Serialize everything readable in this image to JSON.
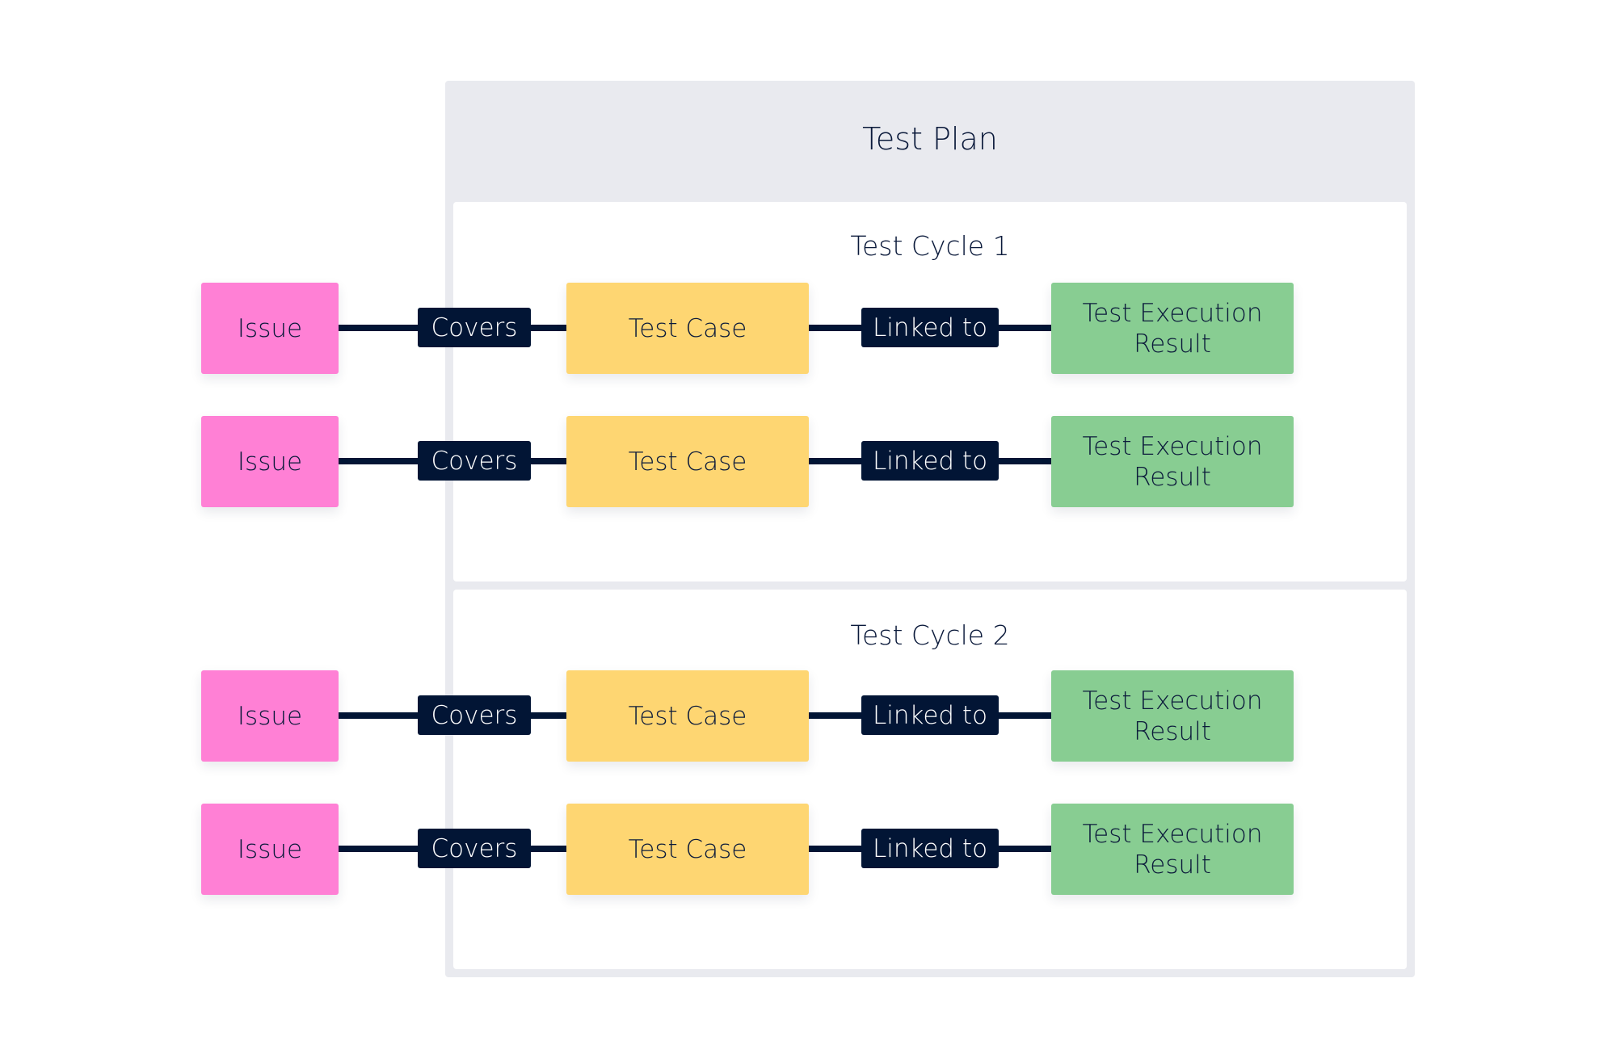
{
  "diagram": {
    "title": "Test Plan",
    "colors": {
      "frame": "#e9eaef",
      "issue": "#ff80d5",
      "test_case": "#fed672",
      "test_execution_result": "#88cd92",
      "connector": "#021535",
      "text": "#0b1a3b"
    },
    "cycles": [
      {
        "title": "Test Cycle 1",
        "rows": [
          {
            "issue": "Issue",
            "covers": "Covers",
            "test_case": "Test Case",
            "linked": "Linked to",
            "result_line1": "Test Execution",
            "result_line2": "Result"
          },
          {
            "issue": "Issue",
            "covers": "Covers",
            "test_case": "Test Case",
            "linked": "Linked to",
            "result_line1": "Test Execution",
            "result_line2": "Result"
          }
        ]
      },
      {
        "title": "Test Cycle 2",
        "rows": [
          {
            "issue": "Issue",
            "covers": "Covers",
            "test_case": "Test Case",
            "linked": "Linked to",
            "result_line1": "Test Execution",
            "result_line2": "Result"
          },
          {
            "issue": "Issue",
            "covers": "Covers",
            "test_case": "Test Case",
            "linked": "Linked to",
            "result_line1": "Test Execution",
            "result_line2": "Result"
          }
        ]
      }
    ]
  }
}
